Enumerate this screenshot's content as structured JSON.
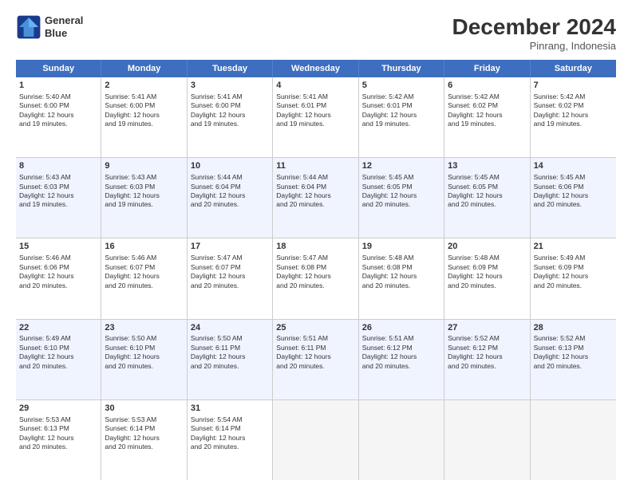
{
  "logo": {
    "line1": "General",
    "line2": "Blue"
  },
  "title": "December 2024",
  "location": "Pinrang, Indonesia",
  "weekdays": [
    "Sunday",
    "Monday",
    "Tuesday",
    "Wednesday",
    "Thursday",
    "Friday",
    "Saturday"
  ],
  "rows": [
    [
      {
        "day": "1",
        "lines": [
          "Sunrise: 5:40 AM",
          "Sunset: 6:00 PM",
          "Daylight: 12 hours",
          "and 19 minutes."
        ]
      },
      {
        "day": "2",
        "lines": [
          "Sunrise: 5:41 AM",
          "Sunset: 6:00 PM",
          "Daylight: 12 hours",
          "and 19 minutes."
        ]
      },
      {
        "day": "3",
        "lines": [
          "Sunrise: 5:41 AM",
          "Sunset: 6:00 PM",
          "Daylight: 12 hours",
          "and 19 minutes."
        ]
      },
      {
        "day": "4",
        "lines": [
          "Sunrise: 5:41 AM",
          "Sunset: 6:01 PM",
          "Daylight: 12 hours",
          "and 19 minutes."
        ]
      },
      {
        "day": "5",
        "lines": [
          "Sunrise: 5:42 AM",
          "Sunset: 6:01 PM",
          "Daylight: 12 hours",
          "and 19 minutes."
        ]
      },
      {
        "day": "6",
        "lines": [
          "Sunrise: 5:42 AM",
          "Sunset: 6:02 PM",
          "Daylight: 12 hours",
          "and 19 minutes."
        ]
      },
      {
        "day": "7",
        "lines": [
          "Sunrise: 5:42 AM",
          "Sunset: 6:02 PM",
          "Daylight: 12 hours",
          "and 19 minutes."
        ]
      }
    ],
    [
      {
        "day": "8",
        "lines": [
          "Sunrise: 5:43 AM",
          "Sunset: 6:03 PM",
          "Daylight: 12 hours",
          "and 19 minutes."
        ]
      },
      {
        "day": "9",
        "lines": [
          "Sunrise: 5:43 AM",
          "Sunset: 6:03 PM",
          "Daylight: 12 hours",
          "and 19 minutes."
        ]
      },
      {
        "day": "10",
        "lines": [
          "Sunrise: 5:44 AM",
          "Sunset: 6:04 PM",
          "Daylight: 12 hours",
          "and 20 minutes."
        ]
      },
      {
        "day": "11",
        "lines": [
          "Sunrise: 5:44 AM",
          "Sunset: 6:04 PM",
          "Daylight: 12 hours",
          "and 20 minutes."
        ]
      },
      {
        "day": "12",
        "lines": [
          "Sunrise: 5:45 AM",
          "Sunset: 6:05 PM",
          "Daylight: 12 hours",
          "and 20 minutes."
        ]
      },
      {
        "day": "13",
        "lines": [
          "Sunrise: 5:45 AM",
          "Sunset: 6:05 PM",
          "Daylight: 12 hours",
          "and 20 minutes."
        ]
      },
      {
        "day": "14",
        "lines": [
          "Sunrise: 5:45 AM",
          "Sunset: 6:06 PM",
          "Daylight: 12 hours",
          "and 20 minutes."
        ]
      }
    ],
    [
      {
        "day": "15",
        "lines": [
          "Sunrise: 5:46 AM",
          "Sunset: 6:06 PM",
          "Daylight: 12 hours",
          "and 20 minutes."
        ]
      },
      {
        "day": "16",
        "lines": [
          "Sunrise: 5:46 AM",
          "Sunset: 6:07 PM",
          "Daylight: 12 hours",
          "and 20 minutes."
        ]
      },
      {
        "day": "17",
        "lines": [
          "Sunrise: 5:47 AM",
          "Sunset: 6:07 PM",
          "Daylight: 12 hours",
          "and 20 minutes."
        ]
      },
      {
        "day": "18",
        "lines": [
          "Sunrise: 5:47 AM",
          "Sunset: 6:08 PM",
          "Daylight: 12 hours",
          "and 20 minutes."
        ]
      },
      {
        "day": "19",
        "lines": [
          "Sunrise: 5:48 AM",
          "Sunset: 6:08 PM",
          "Daylight: 12 hours",
          "and 20 minutes."
        ]
      },
      {
        "day": "20",
        "lines": [
          "Sunrise: 5:48 AM",
          "Sunset: 6:09 PM",
          "Daylight: 12 hours",
          "and 20 minutes."
        ]
      },
      {
        "day": "21",
        "lines": [
          "Sunrise: 5:49 AM",
          "Sunset: 6:09 PM",
          "Daylight: 12 hours",
          "and 20 minutes."
        ]
      }
    ],
    [
      {
        "day": "22",
        "lines": [
          "Sunrise: 5:49 AM",
          "Sunset: 6:10 PM",
          "Daylight: 12 hours",
          "and 20 minutes."
        ]
      },
      {
        "day": "23",
        "lines": [
          "Sunrise: 5:50 AM",
          "Sunset: 6:10 PM",
          "Daylight: 12 hours",
          "and 20 minutes."
        ]
      },
      {
        "day": "24",
        "lines": [
          "Sunrise: 5:50 AM",
          "Sunset: 6:11 PM",
          "Daylight: 12 hours",
          "and 20 minutes."
        ]
      },
      {
        "day": "25",
        "lines": [
          "Sunrise: 5:51 AM",
          "Sunset: 6:11 PM",
          "Daylight: 12 hours",
          "and 20 minutes."
        ]
      },
      {
        "day": "26",
        "lines": [
          "Sunrise: 5:51 AM",
          "Sunset: 6:12 PM",
          "Daylight: 12 hours",
          "and 20 minutes."
        ]
      },
      {
        "day": "27",
        "lines": [
          "Sunrise: 5:52 AM",
          "Sunset: 6:12 PM",
          "Daylight: 12 hours",
          "and 20 minutes."
        ]
      },
      {
        "day": "28",
        "lines": [
          "Sunrise: 5:52 AM",
          "Sunset: 6:13 PM",
          "Daylight: 12 hours",
          "and 20 minutes."
        ]
      }
    ],
    [
      {
        "day": "29",
        "lines": [
          "Sunrise: 5:53 AM",
          "Sunset: 6:13 PM",
          "Daylight: 12 hours",
          "and 20 minutes."
        ]
      },
      {
        "day": "30",
        "lines": [
          "Sunrise: 5:53 AM",
          "Sunset: 6:14 PM",
          "Daylight: 12 hours",
          "and 20 minutes."
        ]
      },
      {
        "day": "31",
        "lines": [
          "Sunrise: 5:54 AM",
          "Sunset: 6:14 PM",
          "Daylight: 12 hours",
          "and 20 minutes."
        ]
      },
      null,
      null,
      null,
      null
    ]
  ]
}
